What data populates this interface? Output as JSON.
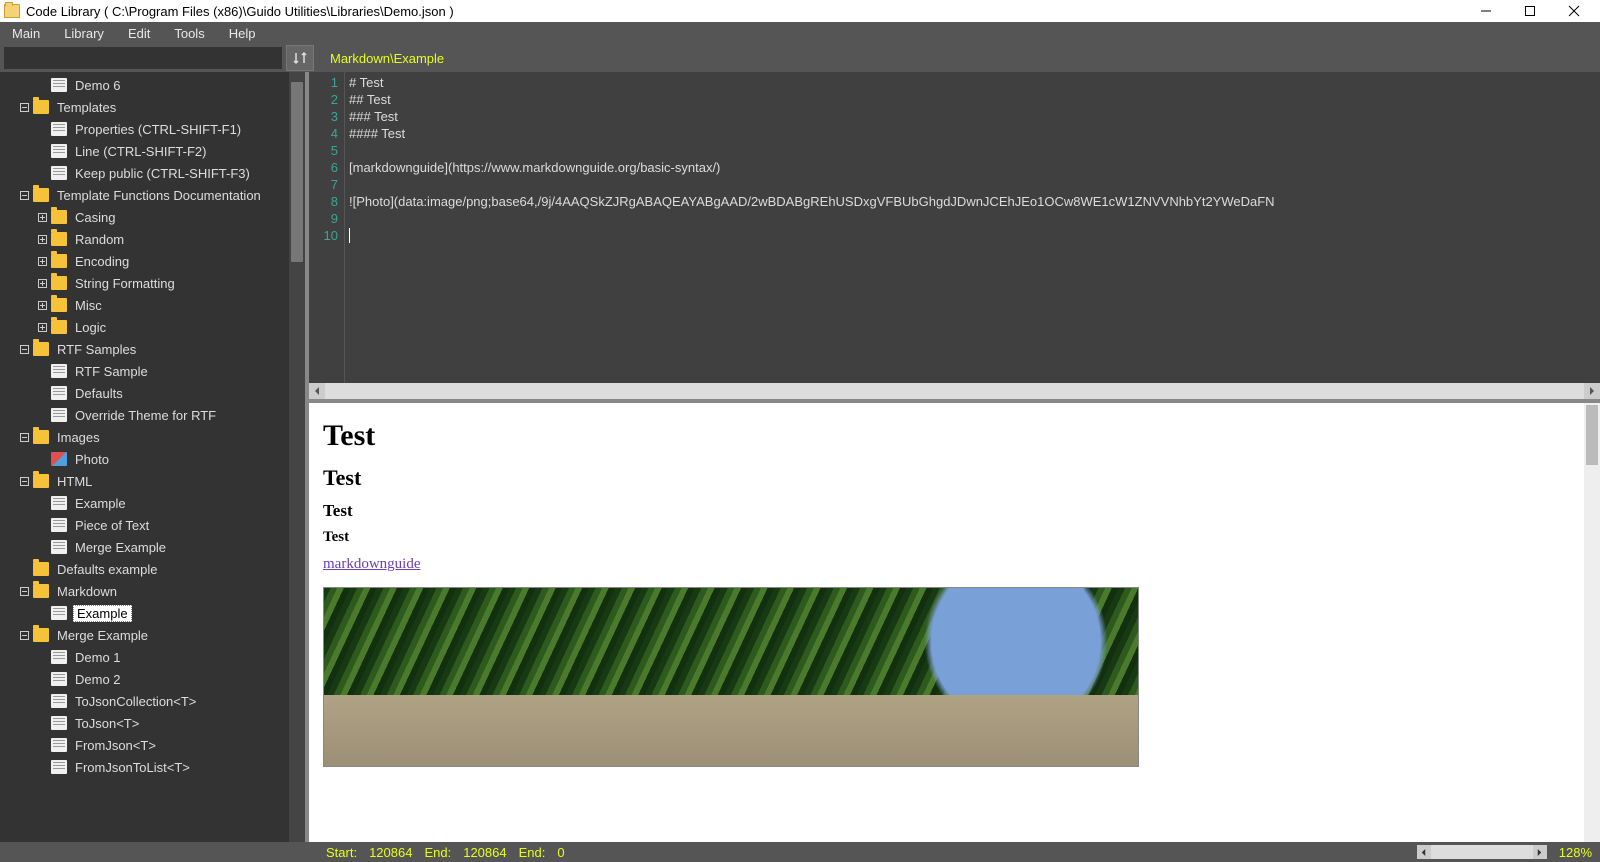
{
  "window": {
    "title": "Code Library ( C:\\Program Files (x86)\\Guido Utilities\\Libraries\\Demo.json )"
  },
  "menu": {
    "items": [
      "Main",
      "Library",
      "Edit",
      "Tools",
      "Help"
    ]
  },
  "toolbar": {
    "search_placeholder": ""
  },
  "breadcrumb": "Markdown\\Example",
  "tree": [
    {
      "depth": 2,
      "type": "file",
      "label": "Demo 6"
    },
    {
      "depth": 1,
      "type": "folder",
      "label": "Templates",
      "toggle": "minus"
    },
    {
      "depth": 2,
      "type": "file",
      "label": "Properties (CTRL-SHIFT-F1)"
    },
    {
      "depth": 2,
      "type": "file",
      "label": "Line (CTRL-SHIFT-F2)"
    },
    {
      "depth": 2,
      "type": "file",
      "label": "Keep public (CTRL-SHIFT-F3)"
    },
    {
      "depth": 1,
      "type": "folder",
      "label": "Template Functions Documentation",
      "toggle": "minus"
    },
    {
      "depth": 2,
      "type": "folder",
      "label": "Casing",
      "toggle": "plus"
    },
    {
      "depth": 2,
      "type": "folder",
      "label": "Random",
      "toggle": "plus"
    },
    {
      "depth": 2,
      "type": "folder",
      "label": "Encoding",
      "toggle": "plus"
    },
    {
      "depth": 2,
      "type": "folder",
      "label": "String Formatting",
      "toggle": "plus"
    },
    {
      "depth": 2,
      "type": "folder",
      "label": "Misc",
      "toggle": "plus"
    },
    {
      "depth": 2,
      "type": "folder",
      "label": "Logic",
      "toggle": "plus"
    },
    {
      "depth": 1,
      "type": "folder",
      "label": "RTF Samples",
      "toggle": "minus"
    },
    {
      "depth": 2,
      "type": "file",
      "label": "RTF Sample"
    },
    {
      "depth": 2,
      "type": "file",
      "label": "Defaults"
    },
    {
      "depth": 2,
      "type": "file",
      "label": "Override Theme for RTF"
    },
    {
      "depth": 1,
      "type": "folder",
      "label": "Images",
      "toggle": "minus"
    },
    {
      "depth": 2,
      "type": "image",
      "label": "Photo"
    },
    {
      "depth": 1,
      "type": "folder",
      "label": "HTML",
      "toggle": "minus"
    },
    {
      "depth": 2,
      "type": "file",
      "label": "Example"
    },
    {
      "depth": 2,
      "type": "file",
      "label": "Piece of Text"
    },
    {
      "depth": 2,
      "type": "file",
      "label": "Merge Example"
    },
    {
      "depth": 1,
      "type": "folder",
      "label": "Defaults example",
      "toggle": "none"
    },
    {
      "depth": 1,
      "type": "folder",
      "label": "Markdown",
      "toggle": "minus"
    },
    {
      "depth": 2,
      "type": "file",
      "label": "Example",
      "selected": true
    },
    {
      "depth": 1,
      "type": "folder",
      "label": "Merge Example",
      "toggle": "minus"
    },
    {
      "depth": 2,
      "type": "file",
      "label": "Demo 1"
    },
    {
      "depth": 2,
      "type": "file",
      "label": "Demo 2"
    },
    {
      "depth": 2,
      "type": "file",
      "label": "ToJsonCollection<T>"
    },
    {
      "depth": 2,
      "type": "file",
      "label": "ToJson<T>"
    },
    {
      "depth": 2,
      "type": "file",
      "label": "FromJson<T>"
    },
    {
      "depth": 2,
      "type": "file",
      "label": "FromJsonToList<T>"
    }
  ],
  "editor": {
    "lines": [
      "# Test",
      "## Test",
      "### Test",
      "#### Test",
      "",
      "[markdownguide](https://www.markdownguide.org/basic-syntax/)",
      "",
      "![Photo](data:image/png;base64,/9j/4AAQSkZJRgABAQEAYABgAAD/2wBDABgREhUSDxgVFBUbGhgdJDwnJCEhJEo1OCw8WE1cW1ZNVVNhbYt2YWeDaFN",
      "",
      ""
    ],
    "line_numbers": [
      "1",
      "2",
      "3",
      "4",
      "5",
      "6",
      "7",
      "8",
      "9",
      "10"
    ]
  },
  "preview": {
    "h1": "Test",
    "h2": "Test",
    "h3": "Test",
    "h4": "Test",
    "link_text": "markdownguide",
    "link_href": "https://www.markdownguide.org/basic-syntax/"
  },
  "status": {
    "start_label": "Start:",
    "start_value": "120864",
    "end_label": "End:",
    "end_value": "120864",
    "end2_label": "End:",
    "end2_value": "0",
    "zoom": "128%"
  }
}
